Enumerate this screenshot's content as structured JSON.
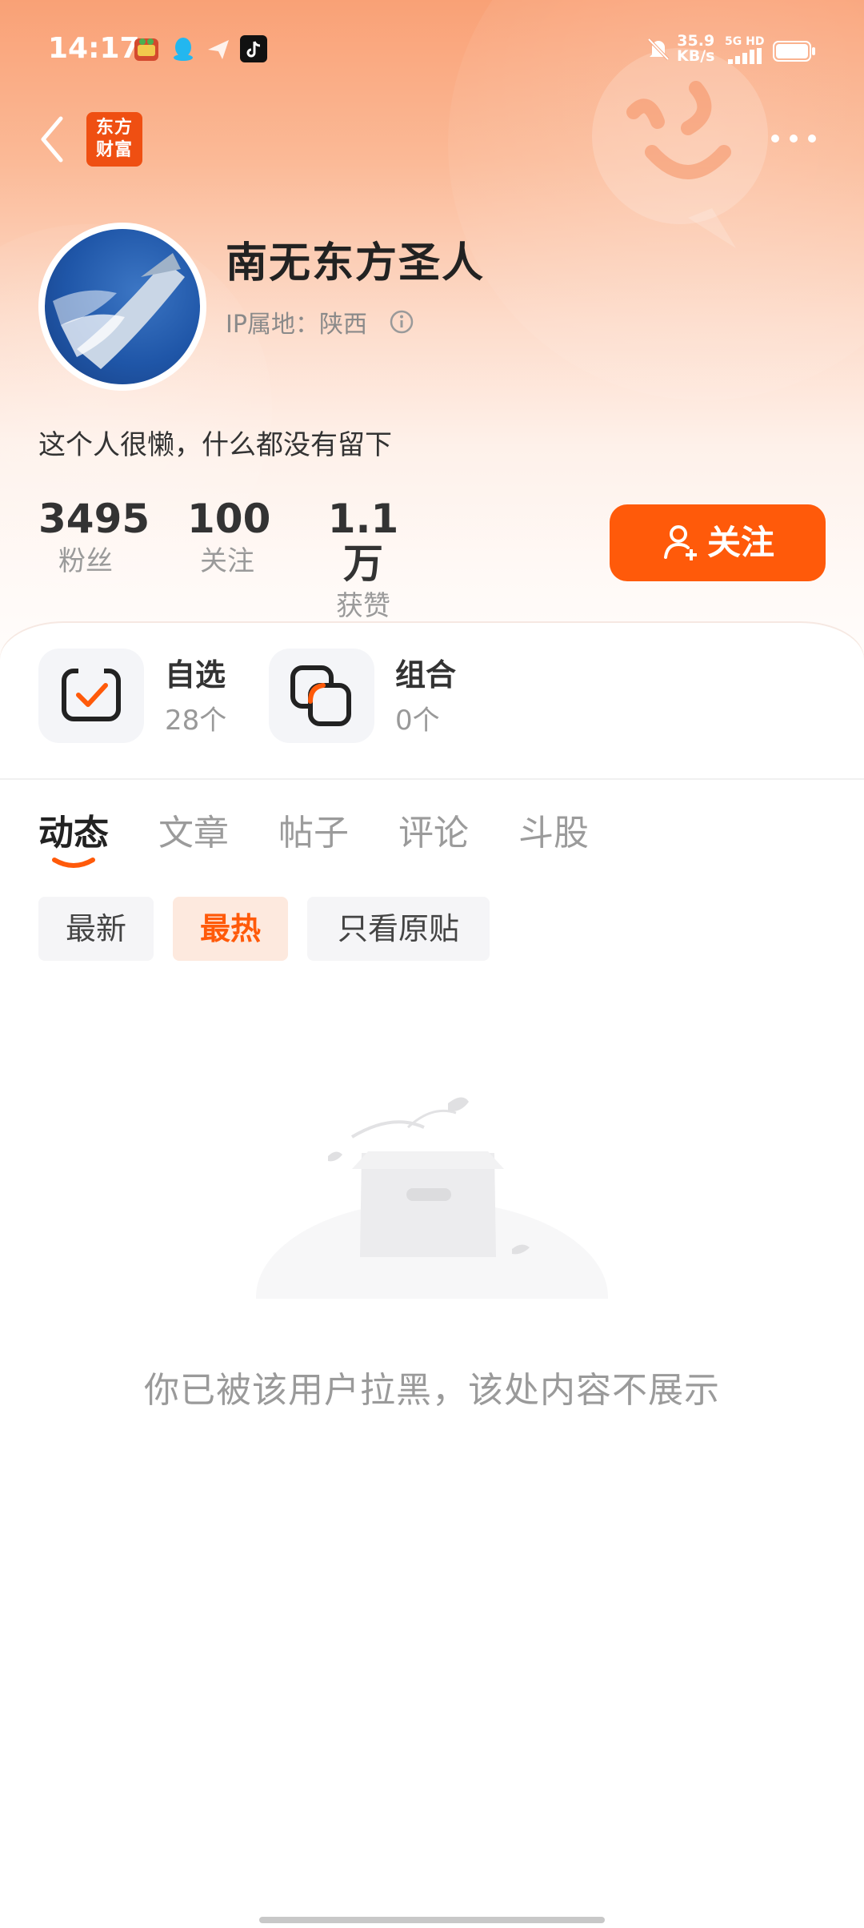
{
  "status_bar": {
    "time": "14:17",
    "net_speed_value": "35.9",
    "net_speed_unit": "KB/s",
    "net_type": "5G HD"
  },
  "header": {
    "app_logo_line1": "东方",
    "app_logo_line2": "财富"
  },
  "profile": {
    "username": "南无东方圣人",
    "ip_location": "IP属地：陕西",
    "bio": "这个人很懒，什么都没有留下",
    "stats": [
      {
        "value": "3495",
        "label": "粉丝"
      },
      {
        "value": "100",
        "label": "关注"
      },
      {
        "value": "1.1万",
        "label": "获赞"
      }
    ],
    "follow_label": "关注"
  },
  "shortcuts": [
    {
      "title": "自选",
      "count": "28个",
      "icon": "watchlist-check-icon"
    },
    {
      "title": "组合",
      "count": "0个",
      "icon": "portfolio-squares-icon"
    }
  ],
  "tabs": [
    "动态",
    "文章",
    "帖子",
    "评论",
    "斗股"
  ],
  "active_tab": "动态",
  "filters": [
    "最新",
    "最热",
    "只看原贴"
  ],
  "active_filter": "最热",
  "empty_state": {
    "message": "你已被该用户拉黑，该处内容不展示"
  },
  "colors": {
    "accent": "#ff5a0a",
    "header_gradient_top": "#f9a176",
    "logo_bg": "#ef4f12"
  }
}
